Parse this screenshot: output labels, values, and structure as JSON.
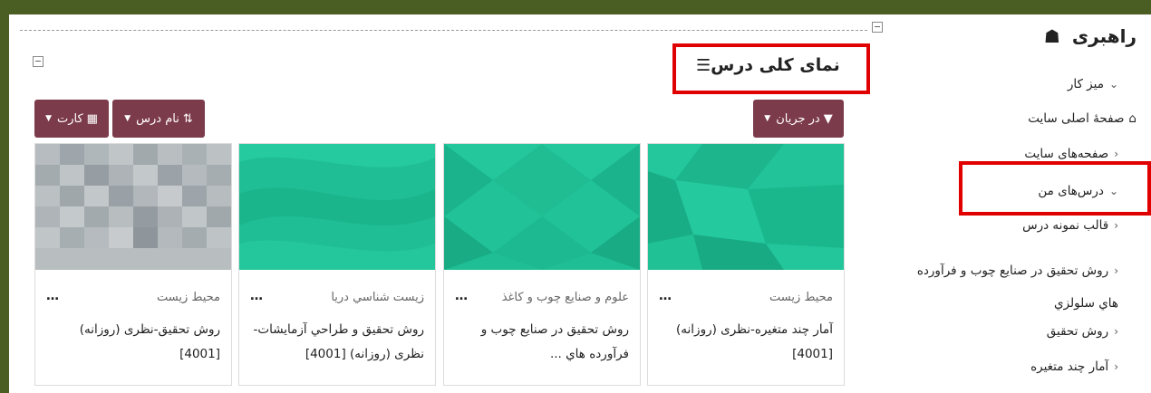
{
  "course_overview": {
    "title": "نمای کلی درس",
    "filter_button": "در جریان",
    "sort_button": "نام درس",
    "view_button": "کارت"
  },
  "courses": [
    {
      "category": "محیط زیست",
      "name": "آمار چند متغیره-نظری (روزانه) [4001]",
      "more": "…"
    },
    {
      "category": "علوم و صنایع چوب و کاغذ",
      "name": "روش تحقیق در صنایع چوب و فرآورده هاي ...",
      "more": "…"
    },
    {
      "category": "زيست شناسي دريا",
      "name": "روش تحقيق و طراحي آزمايشات-نظری (روزانه) [4001]",
      "more": "…"
    },
    {
      "category": "محیط زیست",
      "name": "روش تحقیق-نظری (روزانه) [4001]",
      "more": "…"
    }
  ],
  "navigation": {
    "title": "راهبری",
    "items": [
      {
        "label": "میز کار"
      },
      {
        "label": "صفحهٔ اصلی سایت"
      },
      {
        "label": "صفحه‌های سایت"
      },
      {
        "label": "درس‌های من"
      },
      {
        "label": "قالب نمونه درس"
      },
      {
        "label": "روش تحقیق در صنایع چوب و فرآورده هاي سلولزي"
      },
      {
        "label": "روش تحقیق"
      },
      {
        "label": "آمار چند متغیره"
      }
    ]
  },
  "colors": {
    "frame": "#4a5d23",
    "button": "#7c3b4b",
    "highlight": "#e00000",
    "card_teal": "#1fbe94"
  }
}
